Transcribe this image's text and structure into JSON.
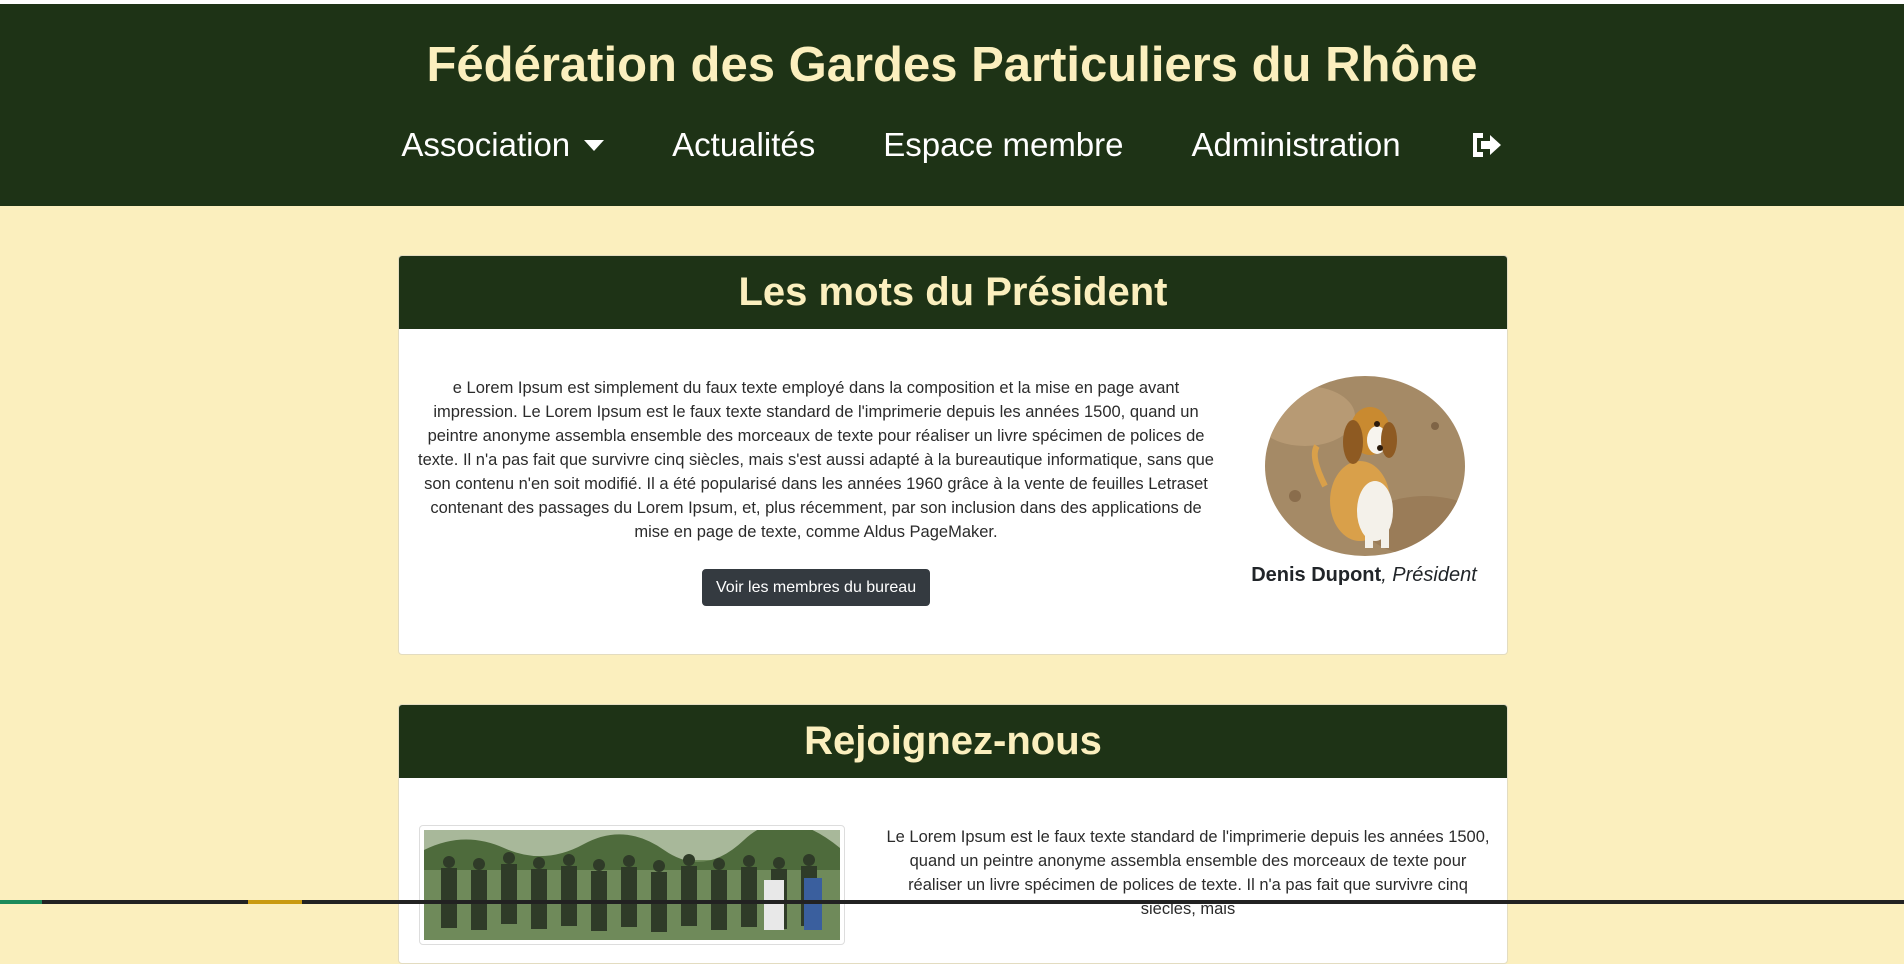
{
  "site": {
    "title": "Fédération des Gardes Particuliers du Rhône"
  },
  "nav": {
    "items": [
      {
        "label": "Association",
        "has_dropdown": true
      },
      {
        "label": "Actualités"
      },
      {
        "label": "Espace membre"
      },
      {
        "label": "Administration"
      }
    ],
    "logout_icon": "sign-out-icon"
  },
  "president_section": {
    "heading": "Les mots du Président",
    "text": "e Lorem Ipsum est simplement du faux texte employé dans la composition et la mise en page avant impression. Le Lorem Ipsum est le faux texte standard de l'imprimerie depuis les années 1500, quand un peintre anonyme assembla ensemble des morceaux de texte pour réaliser un livre spécimen de polices de texte. Il n'a pas fait que survivre cinq siècles, mais s'est aussi adapté à la bureautique informatique, sans que son contenu n'en soit modifié. Il a été popularisé dans les années 1960 grâce à la vente de feuilles Letraset contenant des passages du Lorem Ipsum, et, plus récemment, par son inclusion dans des applications de mise en page de texte, comme Aldus PageMaker.",
    "button_label": "Voir les membres du bureau",
    "president_name": "Denis Dupont",
    "president_role": ", Président"
  },
  "join_section": {
    "heading": "Rejoignez-nous",
    "text": "Le Lorem Ipsum est le faux texte standard de l'imprimerie depuis les années 1500, quand un peintre anonyme assembla ensemble des morceaux de texte pour réaliser un livre spécimen de polices de texte. Il n'a pas fait que survivre cinq siècles, mais"
  },
  "colors": {
    "primary_dark_green": "#1e3316",
    "cream": "#fbefbe",
    "button_dark": "#343a40"
  }
}
